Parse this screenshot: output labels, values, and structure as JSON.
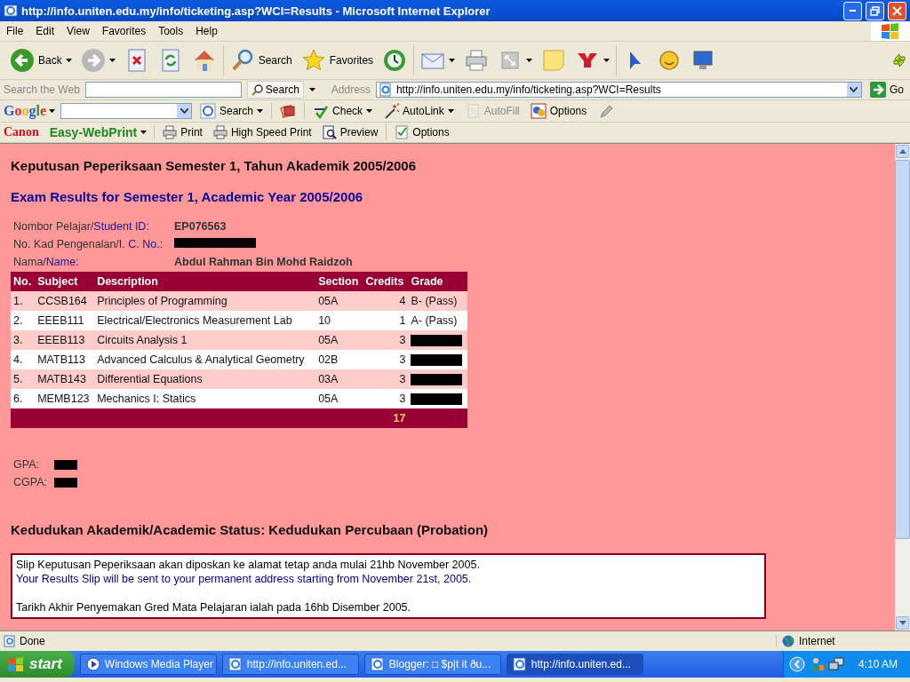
{
  "window": {
    "title": "http://info.uniten.edu.my/info/ticketing.asp?WCI=Results - Microsoft Internet Explorer"
  },
  "menu": [
    "File",
    "Edit",
    "View",
    "Favorites",
    "Tools",
    "Help"
  ],
  "toolbar": [
    [
      {
        "label": "Back",
        "dropdown": true
      },
      {
        "dropdown": true
      },
      {
        "dropdown": false
      },
      {
        "dropdown": false
      },
      {
        "dropdown": false
      }
    ],
    [
      {
        "label": "Search",
        "dropdown": false
      },
      {
        "label": "Favorites",
        "dropdown": false
      },
      {
        "dropdown": false
      }
    ],
    [
      {
        "dropdown": true
      },
      {
        "dropdown": false
      },
      {
        "dropdown": true
      },
      {
        "dropdown": false
      },
      {
        "dropdown": true
      }
    ],
    [
      {
        "dropdown": false
      },
      {
        "dropdown": false
      },
      {
        "dropdown": false
      }
    ]
  ],
  "search_bar": {
    "label": "Search the Web",
    "button": "Search",
    "address_label": "Address",
    "address": "http://info.uniten.edu.my/info/ticketing.asp?WCI=Results",
    "go": "Go"
  },
  "google_bar": {
    "logo": "Google",
    "items": [
      {
        "label": "Search",
        "dropdown": true,
        "disabled": false
      },
      {
        "dropdown": false,
        "disabled": false
      },
      {
        "label": "Check",
        "dropdown": true,
        "disabled": false
      },
      {
        "label": "AutoLink",
        "dropdown": true,
        "disabled": false
      },
      {
        "label": "AutoFill",
        "dropdown": false,
        "disabled": true
      },
      {
        "label": "Options",
        "dropdown": false,
        "disabled": false
      },
      {
        "dropdown": false,
        "disabled": false
      }
    ]
  },
  "canon_bar": {
    "brand": "Canon",
    "product": "Easy-WebPrint",
    "items": [
      "Print",
      "High Speed Print",
      "Preview",
      "Options"
    ]
  },
  "page": {
    "heading_ms": "Keputusan Peperiksaan Semester 1, Tahun Akademik 2005/2006",
    "heading_en": "Exam Results for Semester 1, Academic Year 2005/2006",
    "fields": [
      {
        "label_ms": "Nombor Pelajar/",
        "label_en": "Student ID:",
        "value": "EP076563",
        "redacted": false
      },
      {
        "label_ms": "No. Kad Pengenalan/",
        "label_en": "I. C. No.:",
        "redacted": true
      },
      {
        "label_ms": "Nama/",
        "label_en": "Name:",
        "value": "Abdul Rahman Bin Mohd Raidzoh",
        "redacted": false
      }
    ],
    "columns": [
      "No.",
      "Subject",
      "Description",
      "Section",
      "Credits",
      "Grade"
    ],
    "rows": [
      {
        "no": "1.",
        "subject": "CCSB164",
        "description": "Principles of Programming",
        "section": "05A",
        "credits": "4",
        "grade": "B- (Pass)",
        "redacted": false
      },
      {
        "no": "2.",
        "subject": "EEEB111",
        "description": "Electrical/Electronics Measurement Lab",
        "section": "10",
        "credits": "1",
        "grade": "A- (Pass)",
        "redacted": false
      },
      {
        "no": "3.",
        "subject": "EEEB113",
        "description": "Circuits Analysis 1",
        "section": "05A",
        "credits": "3",
        "redacted": true
      },
      {
        "no": "4.",
        "subject": "MATB113",
        "description": "Advanced Calculus & Analytical Geometry",
        "section": "02B",
        "credits": "3",
        "redacted": true
      },
      {
        "no": "5.",
        "subject": "MATB143",
        "description": "Differential Equations",
        "section": "03A",
        "credits": "3",
        "redacted": true
      },
      {
        "no": "6.",
        "subject": "MEMB123",
        "description": "Mechanics I: Statics",
        "section": "05A",
        "credits": "3",
        "redacted": true
      }
    ],
    "total_credits": "17",
    "gpa": {
      "label": "GPA:",
      "redacted": true
    },
    "cgpa": {
      "label": "CGPA:",
      "redacted": true
    },
    "status": "Kedudukan Akademik/Academic Status: Kedudukan Percubaan (Probation)",
    "notice": [
      {
        "text": "Slip Keputusan Peperiksaan akan diposkan ke alamat tetap anda mulai 21hb November 2005.",
        "color": "#000000"
      },
      {
        "text": "Your Results Slip will be sent to your permanent address starting from November 21st, 2005.",
        "color": "#000080"
      },
      {
        "text": "Tarikh Akhir Penyemakan Gred Mata Pelajaran ialah pada 16hb Disember 2005.",
        "color": "#000000"
      }
    ]
  },
  "status_bar": {
    "text": "Done",
    "zone": "Internet"
  },
  "taskbar": {
    "start": "start",
    "tasks": [
      {
        "label": "Windows Media Player",
        "selected": false
      },
      {
        "label": "http://info.uniten.ed...",
        "selected": false
      },
      {
        "label": "Blogger: □ $p|t it ðu...",
        "selected": false
      },
      {
        "label": "http://info.uniten.ed...",
        "selected": true
      }
    ],
    "clock": "4:10 AM"
  }
}
